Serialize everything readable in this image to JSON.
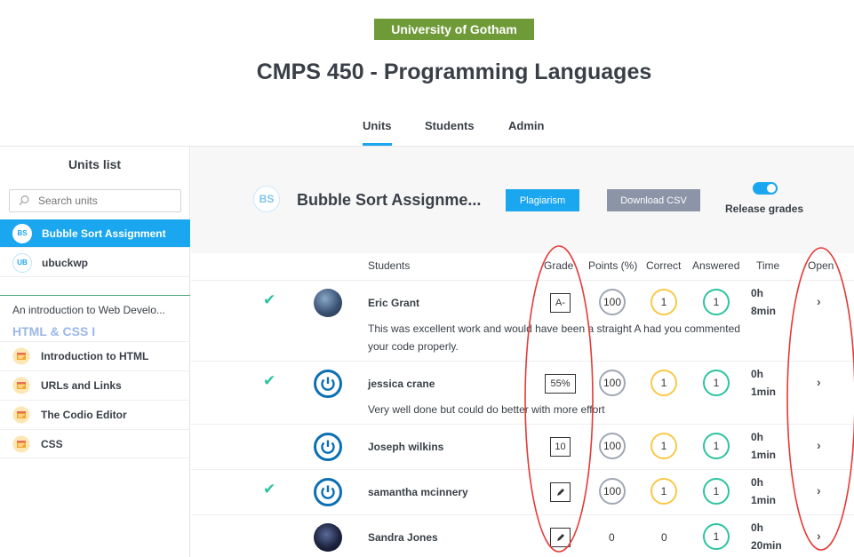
{
  "header": {
    "org": "University of Gotham",
    "course_title": "CMPS 450 - Programming Languages",
    "tabs": [
      {
        "label": "Units"
      },
      {
        "label": "Students"
      },
      {
        "label": "Admin"
      }
    ]
  },
  "sidebar": {
    "title": "Units list",
    "search_placeholder": "Search units",
    "units": [
      {
        "badge": "BS",
        "label": "Bubble Sort Assignment"
      },
      {
        "badge": "UB",
        "label": "ubuckwp"
      }
    ],
    "module_title": "An introduction to Web Develo...",
    "module_section": "HTML & CSS I",
    "lessons": [
      {
        "label": "Introduction to HTML"
      },
      {
        "label": "URLs and Links"
      },
      {
        "label": "The Codio Editor"
      },
      {
        "label": "CSS"
      }
    ]
  },
  "unit": {
    "badge": "BS",
    "title": "Bubble Sort Assignme...",
    "plagiarism_label": "Plagiarism",
    "download_label": "Download CSV",
    "release_label": "Release grades"
  },
  "table": {
    "headers": {
      "students": "Students",
      "grade": "Grade",
      "points": "Points (%)",
      "correct": "Correct",
      "answered": "Answered",
      "time": "Time",
      "open": "Open"
    },
    "rows": [
      {
        "name": "Eric Grant",
        "grade": "A-",
        "points": "100",
        "correct": "1",
        "answered": "1",
        "time_h": "0h",
        "time_m": "8min",
        "comment1": "This was excellent work and would have been a straight A had you commented",
        "comment2": "your code properly."
      },
      {
        "name": "jessica crane",
        "grade": "55%",
        "points": "100",
        "correct": "1",
        "answered": "1",
        "time_h": "0h",
        "time_m": "1min",
        "comment1": "Very well done but could do better with more effort"
      },
      {
        "name": "Joseph wilkins",
        "grade": "10",
        "points": "100",
        "correct": "1",
        "answered": "1",
        "time_h": "0h",
        "time_m": "1min"
      },
      {
        "name": "samantha mcinnery",
        "points": "100",
        "correct": "1",
        "answered": "1",
        "time_h": "0h",
        "time_m": "1min"
      },
      {
        "name": "Sandra Jones",
        "points": "0",
        "correct": "0",
        "answered": "1",
        "time_h": "0h",
        "time_m": "20min"
      }
    ]
  },
  "colors": {
    "accent": "#1ba6f0",
    "org": "#6f9a38",
    "check": "#2cc3a0",
    "annotation": "#e53935"
  }
}
